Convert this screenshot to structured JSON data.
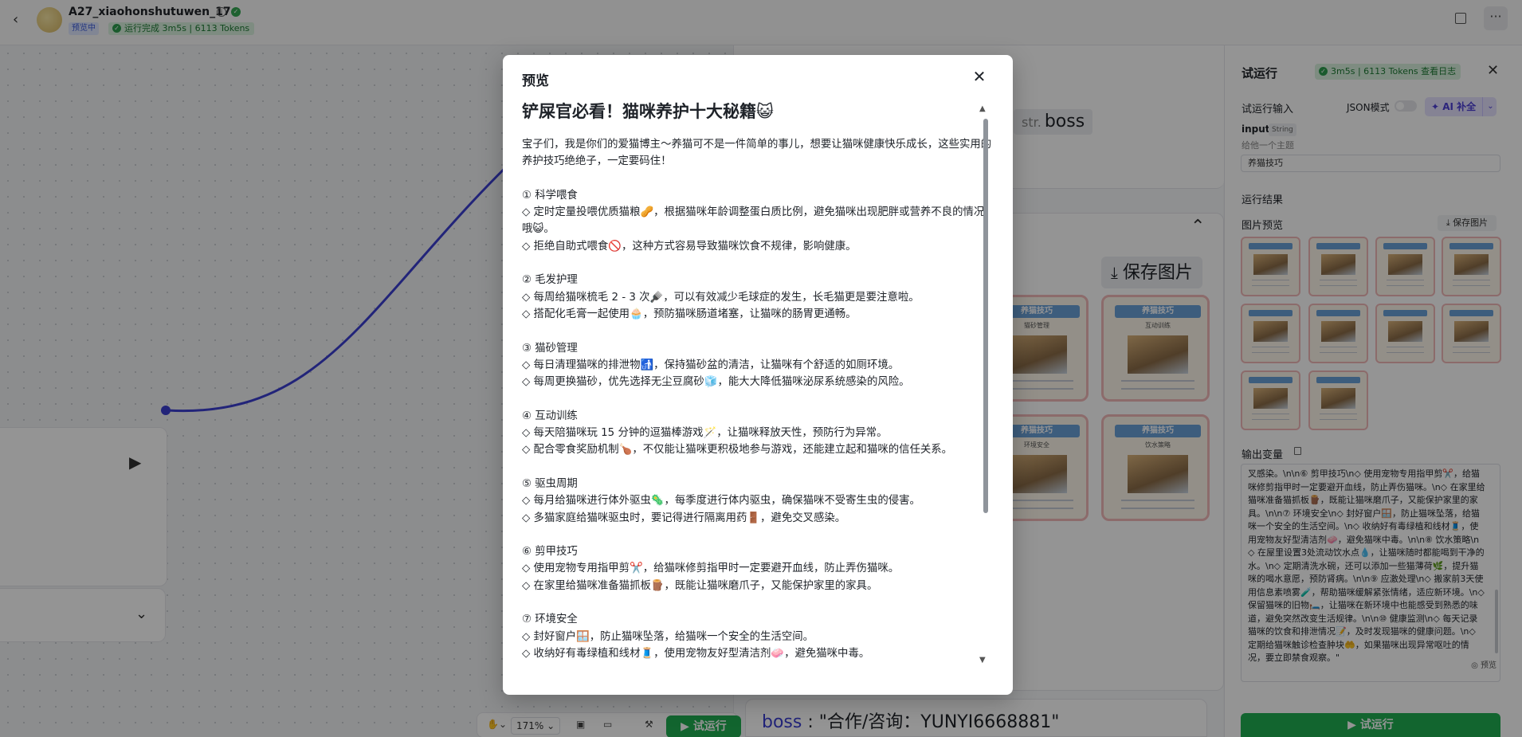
{
  "header": {
    "app_title": "A27_xiaohonshutuwen_17",
    "tag": "预览中",
    "run_status": "运行完成 3m5s | 6113 Tokens"
  },
  "canvas": {
    "stroke_color": "#3b3fd1",
    "boss_tag": {
      "type": "str.",
      "value": "boss"
    },
    "save_image_label": "保存图片",
    "image_cards": [
      {
        "title": "养猫技巧",
        "subtitle": "猫砂管理"
      },
      {
        "title": "养猫技巧",
        "subtitle": "互动训练"
      },
      {
        "title": "养猫技巧",
        "subtitle": "环境安全"
      },
      {
        "title": "养猫技巧",
        "subtitle": "饮水策略"
      }
    ],
    "boss_output": {
      "key": "boss",
      "value": "\"合作/咨询：YUNYI6668881\""
    },
    "zoom": "171%",
    "run_label": "试运行"
  },
  "right_panel": {
    "title": "试运行",
    "status": "3m5s | 6113 Tokens",
    "view_log": "查看日志",
    "input_section": "试运行输入",
    "json_mode": "JSON模式",
    "ai_fill": "AI 补全",
    "input_name": "input",
    "input_type": "String",
    "input_hint": "给他一个主题",
    "input_value": "养猫技巧",
    "result_section": "运行结果",
    "image_preview": "图片预览",
    "save_image": "保存图片",
    "output_var": "输出变量",
    "output_text": "叉感染。\\n\\n⑥ 剪甲技巧\\n◇ 使用宠物专用指甲剪✂️，给猫咪修剪指甲时一定要避开血线，防止弄伤猫咪。\\n◇ 在家里给猫咪准备猫抓板🪵，既能让猫咪磨爪子，又能保护家里的家具。\\n\\n⑦ 环境安全\\n◇ 封好窗户🪟，防止猫咪坠落，给猫咪一个安全的生活空间。\\n◇ 收纳好有毒绿植和线材🧵，使用宠物友好型清洁剂🧼，避免猫咪中毒。\\n\\n⑧ 饮水策略\\n◇ 在屋里设置3处流动饮水点💧，让猫咪随时都能喝到干净的水。\\n◇ 定期清洗水碗，还可以添加一些猫薄荷🌿，提升猫咪的喝水意愿，预防肾病。\\n\\n⑨ 应激处理\\n◇ 搬家前3天使用信息素喷雾🧪，帮助猫咪缓解紧张情绪，适应新环境。\\n◇ 保留猫咪的旧物🛏️，让猫咪在新环境中也能感受到熟悉的味道，避免突然改变生活规律。\\n\\n⑩ 健康监测\\n◇ 每天记录猫咪的饮食和排泄情况📝，及时发现猫咪的健康问题。\\n◇ 定期给猫咪触诊检查肿块🤲，如果猫咪出现异常呕吐的情况，要立即禁食观察。\"",
    "preview": "◎ 预览",
    "run_button": "试运行"
  },
  "modal": {
    "title": "预览",
    "post_title": "铲屎官必看！猫咪养护十大秘籍😺",
    "post_body": "宝子们，我是你们的爱猫博主～养猫可不是一件简单的事儿，想要让猫咪健康快乐成长，这些实用的养护技巧绝绝子，一定要码住！\n\n① 科学喂食\n◇ 定时定量投喂优质猫粮🥜，根据猫咪年龄调整蛋白质比例，避免猫咪出现肥胖或营养不良的情况哦😺。\n◇ 拒绝自助式喂食🚫，这种方式容易导致猫咪饮食不规律，影响健康。\n\n② 毛发护理\n◇ 每周给猫咪梳毛 2 - 3 次🪮，可以有效减少毛球症的发生，长毛猫更是要注意啦。\n◇ 搭配化毛膏一起使用🧁，预防猫咪肠道堵塞，让猫咪的肠胃更通畅。\n\n③ 猫砂管理\n◇ 每日清理猫咪的排泄物🚮，保持猫砂盆的清洁，让猫咪有个舒适的如厕环境。\n◇ 每周更换猫砂，优先选择无尘豆腐砂🧊，能大大降低猫咪泌尿系统感染的风险。\n\n④ 互动训练\n◇ 每天陪猫咪玩 15 分钟的逗猫棒游戏🪄，让猫咪释放天性，预防行为异常。\n◇ 配合零食奖励机制🍗，不仅能让猫咪更积极地参与游戏，还能建立起和猫咪的信任关系。\n\n⑤ 驱虫周期\n◇ 每月给猫咪进行体外驱虫🦠，每季度进行体内驱虫，确保猫咪不受寄生虫的侵害。\n◇ 多猫家庭给猫咪驱虫时，要记得进行隔离用药🚪，避免交叉感染。\n\n⑥ 剪甲技巧\n◇ 使用宠物专用指甲剪✂️，给猫咪修剪指甲时一定要避开血线，防止弄伤猫咪。\n◇ 在家里给猫咪准备猫抓板🪵，既能让猫咪磨爪子，又能保护家里的家具。\n\n⑦ 环境安全\n◇ 封好窗户🪟，防止猫咪坠落，给猫咪一个安全的生活空间。\n◇ 收纳好有毒绿植和线材🧵，使用宠物友好型清洁剂🧼，避免猫咪中毒。"
  },
  "colors": {
    "accent_green": "#1fae52",
    "link_blue": "#3b3fd1",
    "ai_purple": "#4c3fd6"
  }
}
